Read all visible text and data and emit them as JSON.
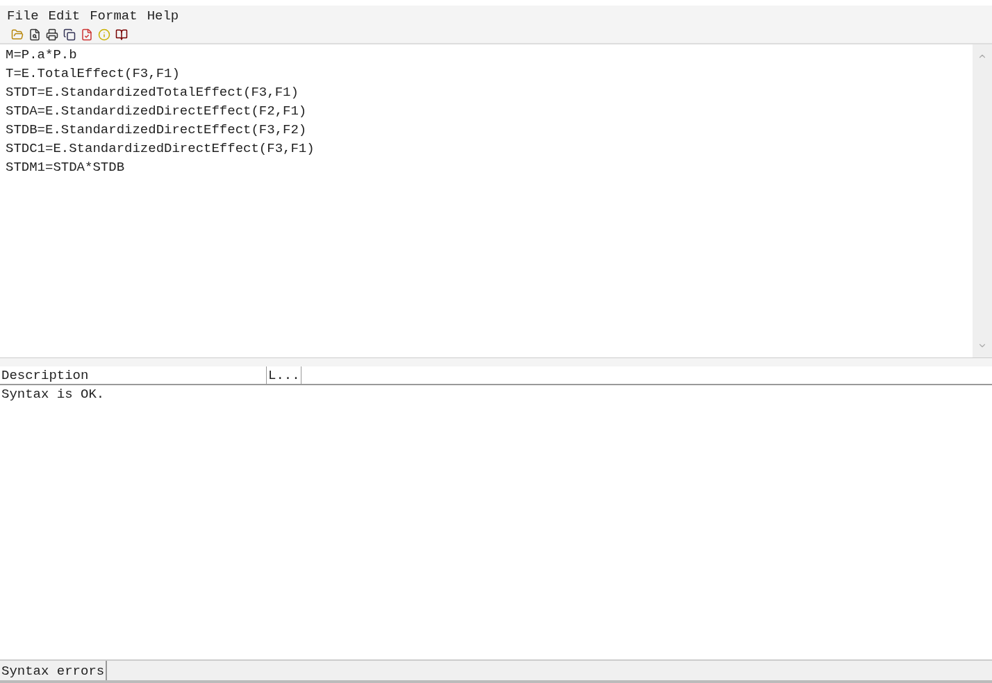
{
  "menu": [
    "File",
    "Edit",
    "Format",
    "Help"
  ],
  "editor": {
    "lines": [
      "M=P.a*P.b",
      "T=E.TotalEffect(F3,F1)",
      "STDT=E.StandardizedTotalEffect(F3,F1)",
      "STDA=E.StandardizedDirectEffect(F2,F1)",
      "STDB=E.StandardizedDirectEffect(F3,F2)",
      "STDC1=E.StandardizedDirectEffect(F3,F1)",
      "STDM1=STDA*STDB"
    ]
  },
  "messages": {
    "columns": [
      "Description",
      "L..."
    ],
    "rows": [
      [
        "Syntax is OK."
      ]
    ]
  },
  "status_bar": {
    "label": "Syntax errors"
  }
}
